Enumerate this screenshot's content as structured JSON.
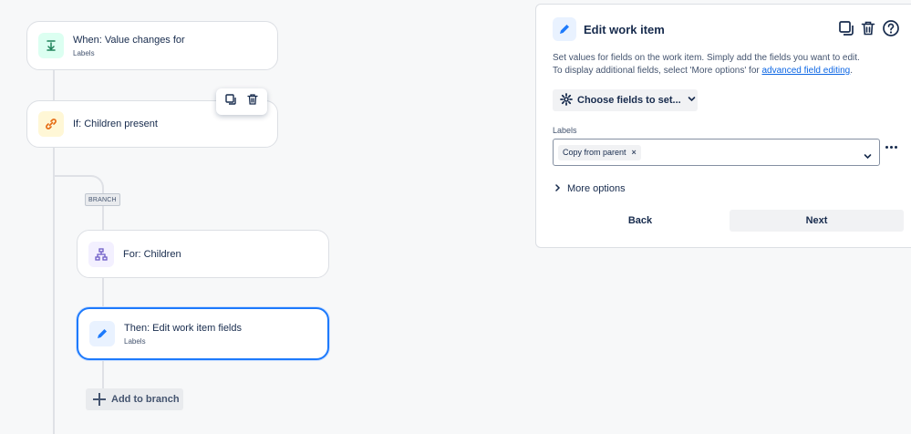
{
  "flow": {
    "trigger": {
      "title": "When: Value changes for",
      "subtitle": "Labels",
      "icon": "download-arrow-icon"
    },
    "condition": {
      "title": "If: Children present",
      "icon": "link-icon"
    },
    "branch_tag": "BRANCH",
    "branch_rule": {
      "title": "For: Children",
      "icon": "hierarchy-icon"
    },
    "action": {
      "title": "Then: Edit work item fields",
      "subtitle": "Labels",
      "icon": "pencil-icon"
    },
    "add_branch_label": "Add to branch"
  },
  "panel": {
    "title": "Edit work item",
    "description_line1": "Set values for fields on the work item. Simply add the fields you want to edit.",
    "description_line2_prefix": "To display additional fields, select 'More options' for ",
    "description_link": "advanced field editing",
    "description_suffix": ".",
    "choose_fields_label": "Choose fields to set...",
    "field_label": "Labels",
    "selected_chip": "Copy from parent",
    "chip_remove": "×",
    "more_options_label": "More options",
    "back_label": "Back",
    "next_label": "Next"
  },
  "colors": {
    "accent": "#1d7afc",
    "link": "#0c66e4",
    "trigger_icon": "#1f845a",
    "condition_icon": "#e56910",
    "branch_icon": "#6e5dc6",
    "action_icon": "#1d7afc"
  }
}
